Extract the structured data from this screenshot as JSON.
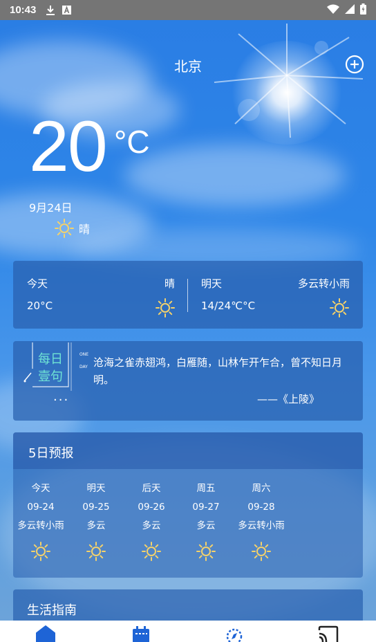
{
  "status_bar": {
    "time": "10:43",
    "icons": [
      "download-icon",
      "text-a-icon",
      "wifi-icon",
      "signal-icon",
      "battery-icon"
    ]
  },
  "header": {
    "city": "北京",
    "add_icon": "plus-circle-icon"
  },
  "current": {
    "temperature": "20",
    "unit": "°C",
    "date": "9月24日",
    "condition": "晴",
    "condition_icon": "sun-icon"
  },
  "today_tomorrow": {
    "today": {
      "label": "今天",
      "condition": "晴",
      "temp": "20°C",
      "icon": "sun-icon"
    },
    "tomorrow": {
      "label": "明天",
      "condition": "多云转小雨",
      "temp": "14/24℃°C",
      "icon": "sun-icon"
    }
  },
  "daily_quote": {
    "badge_line1": "每日",
    "badge_line2": "壹句",
    "badge_small_top": "ONE",
    "badge_small_bottom": "DAY",
    "more": "···",
    "text": "沧海之雀赤翅鸿，白雁随，山林乍开乍合，曾不知日月明。",
    "source": "——《上陵》"
  },
  "forecast": {
    "title": "5日预报",
    "days": [
      {
        "day": "今天",
        "date": "09-24",
        "condition": "多云转小雨",
        "icon": "sun-icon"
      },
      {
        "day": "明天",
        "date": "09-25",
        "condition": "多云",
        "icon": "sun-icon"
      },
      {
        "day": "后天",
        "date": "09-26",
        "condition": "多云",
        "icon": "sun-icon"
      },
      {
        "day": "周五",
        "date": "09-27",
        "condition": "多云",
        "icon": "sun-icon"
      },
      {
        "day": "周六",
        "date": "09-28",
        "condition": "多云转小雨",
        "icon": "sun-icon"
      }
    ]
  },
  "life_guide": {
    "title": "生活指南"
  },
  "tabs": [
    {
      "icon": "home-icon"
    },
    {
      "icon": "calendar-icon"
    },
    {
      "icon": "compass-icon"
    },
    {
      "icon": "cast-icon"
    }
  ],
  "colors": {
    "accent_tab": "#1e64d6",
    "sun_icon": "#f5d26a",
    "badge_teal": "#6fe4d4"
  }
}
